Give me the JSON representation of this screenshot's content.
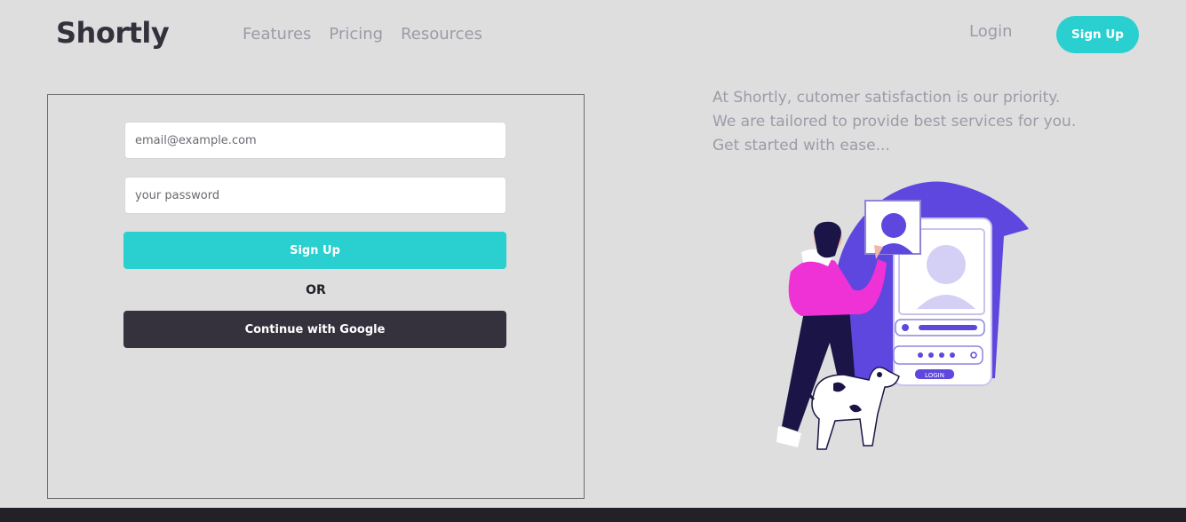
{
  "brand": {
    "logo": "Shortly",
    "accent": "#2acfcf",
    "dark": "#35323e"
  },
  "nav": {
    "items": [
      "Features",
      "Pricing",
      "Resources"
    ],
    "login": "Login",
    "signup": "Sign Up"
  },
  "form": {
    "email_placeholder": "email@example.com",
    "password_placeholder": "your password",
    "signup_label": "Sign Up",
    "or_label": "OR",
    "google_label": "Continue with Google"
  },
  "tagline": {
    "line1": "At Shortly, cutomer satisfaction is our priority.",
    "line2": "We are tailored to provide best services for you.",
    "line3": "Get started with ease..."
  },
  "illustration": {
    "login_label": "LOGIN"
  }
}
